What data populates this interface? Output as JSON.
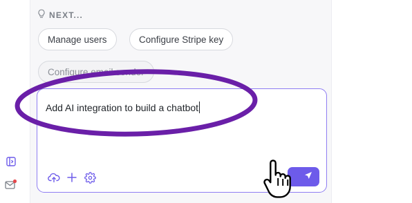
{
  "next_section": {
    "header": "NEXT...",
    "icon": "lightbulb-icon",
    "suggestions": [
      {
        "label": "Manage users"
      },
      {
        "label": "Configure Stripe key"
      },
      {
        "label": "Configure email sender"
      }
    ]
  },
  "composer": {
    "value": "Add AI integration to build a chatbot",
    "tools": [
      "upload-cloud-icon",
      "plus-icon",
      "gear-icon"
    ],
    "send_icon": "send-icon"
  },
  "left_rail": {
    "icons": [
      "sidebar-toggle-icon",
      "mail-icon"
    ],
    "notification_color": "#e5484d"
  },
  "annotation": {
    "color": "#6a1fa8",
    "cursor": "hand-pointer-icon"
  },
  "colors": {
    "accent": "#6d5bea",
    "composer_border": "#8e7cf2"
  }
}
